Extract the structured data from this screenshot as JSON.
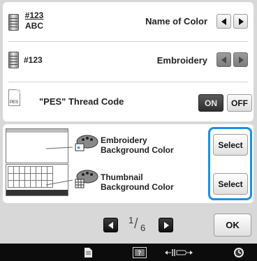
{
  "settings": {
    "name_of_color": {
      "code_line1": "#123",
      "code_line2": "ABC",
      "label": "Name of Color"
    },
    "embroidery": {
      "code": "#123",
      "label": "Embroidery"
    },
    "pes_thread": {
      "file_label": "PES",
      "label": "\"PES\" Thread Code",
      "on_label": "ON",
      "off_label": "OFF"
    }
  },
  "background": {
    "embroidery_label_1": "Embroidery",
    "embroidery_label_2": "Background Color",
    "thumbnail_label_1": "Thumbnail",
    "thumbnail_label_2": "Background Color",
    "select_label": "Select",
    "highlight_color": "#1d8fe0"
  },
  "pager": {
    "current": "1",
    "total": "6",
    "ok_label": "OK"
  },
  "bottom_bar": {
    "icons": [
      "page-icon",
      "help-icon",
      "width-icon",
      "clock-icon"
    ]
  }
}
